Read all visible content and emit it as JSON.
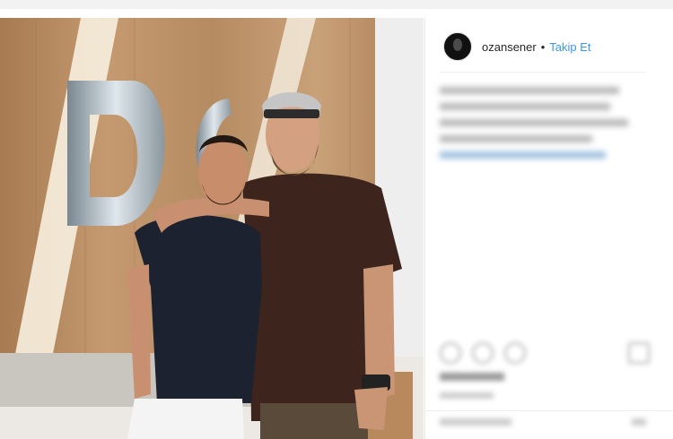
{
  "post": {
    "username": "ozansener",
    "separator": "•",
    "follow_label": "Takip Et"
  },
  "icons": {
    "avatar": "profile-photo",
    "like": "heart-icon",
    "comment": "comment-icon",
    "share": "share-icon",
    "save": "bookmark-icon",
    "more": "more-options-icon"
  },
  "colors": {
    "link": "#3897f0",
    "text": "#262626",
    "wood": "#b98e64"
  }
}
